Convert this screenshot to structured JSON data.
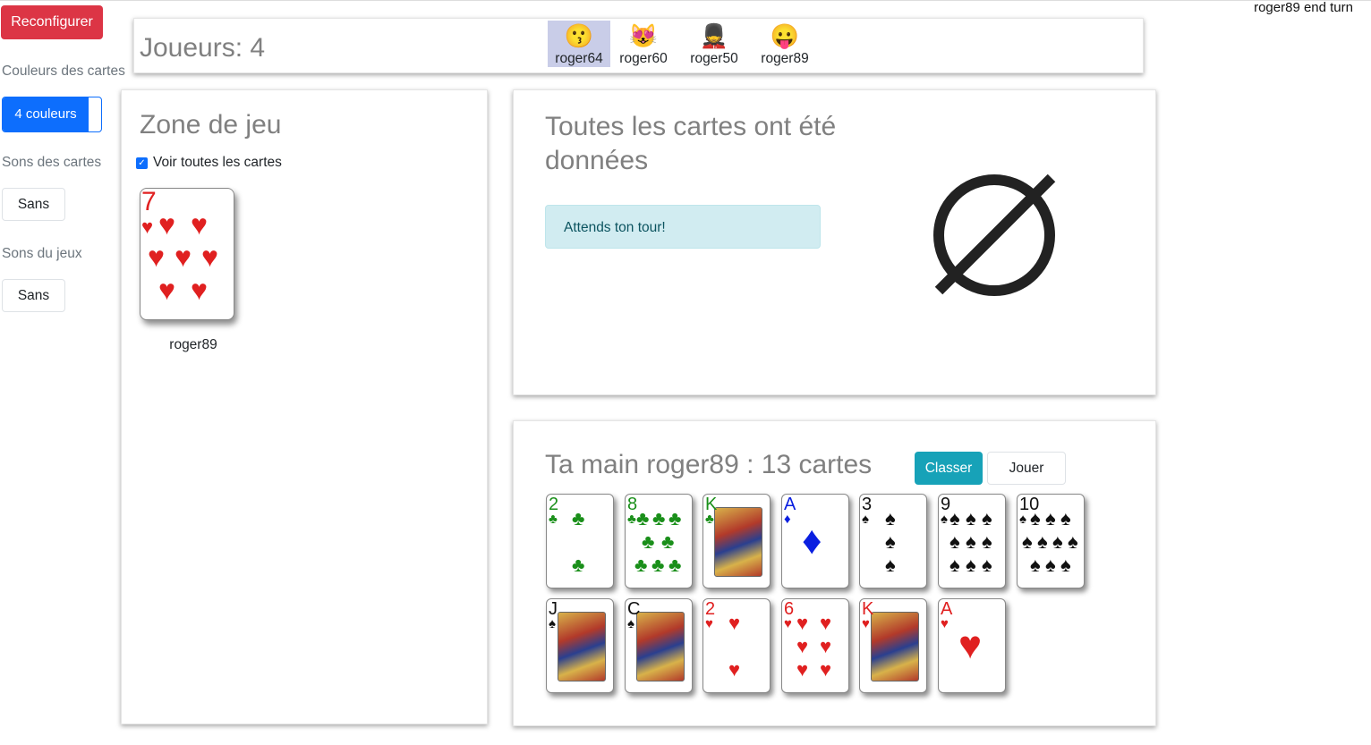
{
  "status_text": "roger89 end turn",
  "sidebar": {
    "reconfigure_label": "Reconfigurer",
    "card_colors_label": "Couleurs des cartes",
    "card_colors_value": "4 couleurs",
    "card_sounds_label": "Sons des cartes",
    "card_sounds_value": "Sans",
    "game_sounds_label": "Sons du jeux",
    "game_sounds_value": "Sans"
  },
  "players": {
    "title": "Joueurs: 4",
    "list": [
      {
        "name": "roger64",
        "emoji": "😗",
        "active": true
      },
      {
        "name": "roger60",
        "emoji": "😻",
        "active": false
      },
      {
        "name": "roger50",
        "emoji": "💂",
        "active": false
      },
      {
        "name": "roger89",
        "emoji": "😛",
        "active": false
      }
    ]
  },
  "play_zone": {
    "title": "Zone de jeu",
    "show_all_label": "Voir toutes les cartes",
    "show_all_checked": true,
    "played_card": {
      "rank": "7",
      "suit": "♥",
      "owner": "roger89"
    }
  },
  "info": {
    "title": "Toutes les cartes ont été données",
    "alert": "Attends ton tour!",
    "icon": "empty-set-icon"
  },
  "hand": {
    "title": "Ta main roger89 : 13 cartes",
    "sort_label": "Classer",
    "play_label": "Jouer",
    "cards": [
      {
        "rank": "2",
        "suit": "♣",
        "color": "green"
      },
      {
        "rank": "8",
        "suit": "♣",
        "color": "green"
      },
      {
        "rank": "K",
        "suit": "♣",
        "color": "green"
      },
      {
        "rank": "A",
        "suit": "♦",
        "color": "blue"
      },
      {
        "rank": "3",
        "suit": "♠",
        "color": "black"
      },
      {
        "rank": "9",
        "suit": "♠",
        "color": "black"
      },
      {
        "rank": "10",
        "suit": "♠",
        "color": "black"
      },
      {
        "rank": "J",
        "suit": "♠",
        "color": "black"
      },
      {
        "rank": "C",
        "suit": "♠",
        "color": "black"
      },
      {
        "rank": "2",
        "suit": "♥",
        "color": "red"
      },
      {
        "rank": "6",
        "suit": "♥",
        "color": "red"
      },
      {
        "rank": "K",
        "suit": "♥",
        "color": "red"
      },
      {
        "rank": "A",
        "suit": "♥",
        "color": "red"
      }
    ]
  },
  "colors": {
    "danger": "#dc3545",
    "primary": "#0d6efd",
    "info": "#17a2b8",
    "alert_bg": "#d1ecf1",
    "heart": "#e02020",
    "club": "#1a8f1a",
    "diamond": "#0a1fe0",
    "spade": "#111111"
  }
}
